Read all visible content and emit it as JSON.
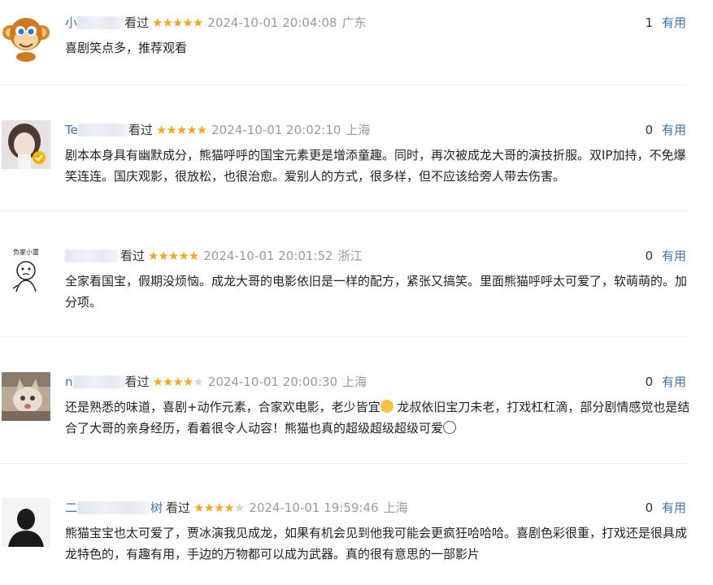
{
  "reviews": [
    {
      "user_visible": "小",
      "watched": "看过",
      "rating": 5,
      "time": "2024-10-01 20:04:08",
      "location": "广东",
      "useful_count": "1",
      "useful_label": "有用",
      "content": "喜剧笑点多，推荐观看"
    },
    {
      "user_visible": "Te",
      "watched": "看过",
      "rating": 5,
      "time": "2024-10-01 20:02:10",
      "location": "上海",
      "useful_count": "0",
      "useful_label": "有用",
      "content": "剧本本身具有幽默成分，熊猫呼呼的国宝元素更是增添童趣。同时，再次被成龙大哥的演技折服。双IP加持，不免爆笑连连。国庆观影，很放松，也很治愈。爱别人的方式，很多样，但不应该给旁人带去伤害。"
    },
    {
      "user_visible": "",
      "watched": "看过",
      "rating": 5,
      "time": "2024-10-01 20:01:52",
      "location": "浙江",
      "avatar_text": "负家小雷",
      "useful_count": "0",
      "useful_label": "有用",
      "content": "全家看国宝，假期没烦恼。成龙大哥的电影依旧是一样的配方，紧张又搞笑。里面熊猫呼呼太可爱了，软萌萌的。加分项。"
    },
    {
      "user_visible": "n",
      "watched": "看过",
      "rating": 4,
      "time": "2024-10-01 20:00:30",
      "location": "上海",
      "useful_count": "0",
      "useful_label": "有用",
      "content_a": "还是熟悉的味道，喜剧+动作元素，合家欢电影，老少皆宜",
      "content_b": " 龙叔依旧宝刀未老，打戏杠杠滴，部分剧情感觉也是结合了大哥的亲身经历，看着很令人动容！熊猫也真的超级超级超级可爱"
    },
    {
      "user_visible": "二",
      "user_suffix": "树",
      "watched": "看过",
      "rating": 4,
      "time": "2024-10-01 19:59:46",
      "location": "上海",
      "useful_count": "0",
      "useful_label": "有用",
      "content": "熊猫宝宝也太可爱了，贾冰演我见成龙，如果有机会见到他我可能会更疯狂哈哈哈。喜剧色彩很重，打戏还是很具成龙特色的，有趣有用，手边的万物都可以成为武器。真的很有意思的一部影片"
    }
  ],
  "colors": {
    "accent": "#3a76b8",
    "star": "#f5a623",
    "meta_gray": "#9a9a9a"
  }
}
